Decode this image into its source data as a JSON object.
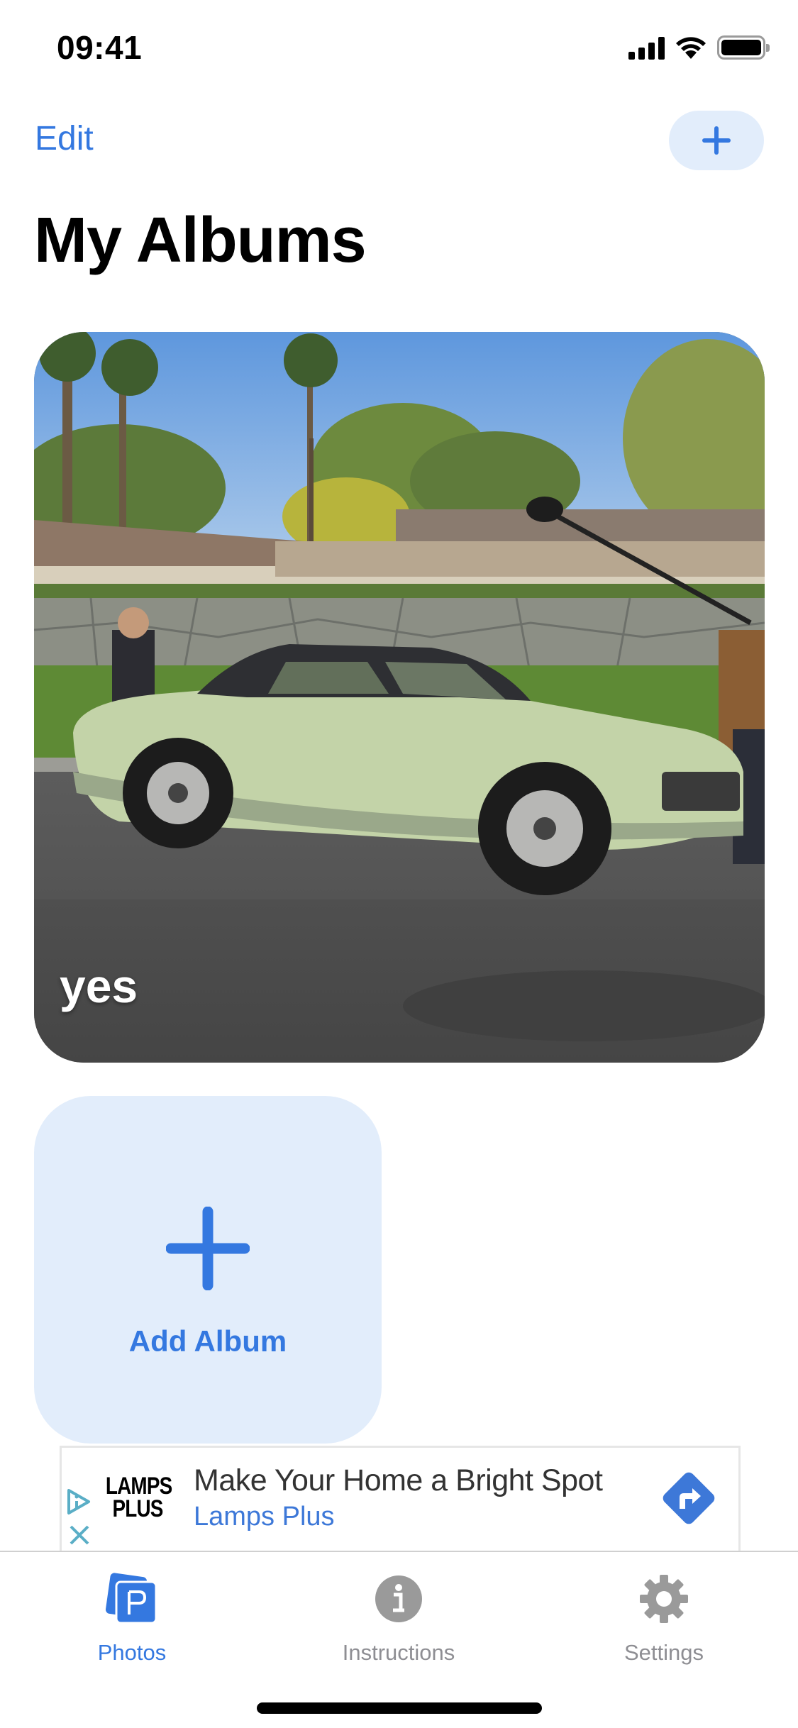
{
  "status_bar": {
    "time": "09:41",
    "icons": [
      "cellular-signal-icon",
      "wifi-icon",
      "battery-icon"
    ]
  },
  "nav": {
    "edit_label": "Edit",
    "add_button_icon": "plus-icon"
  },
  "page": {
    "title": "My Albums"
  },
  "albums": [
    {
      "title": "yes",
      "thumbnail": "photo of a pale green classic car parked on a street"
    }
  ],
  "add_album": {
    "label": "Add Album",
    "icon": "plus-icon"
  },
  "ad": {
    "logo_line1": "LAMPS",
    "logo_line2": "PLUS",
    "headline": "Make Your Home a Bright Spot",
    "advertiser": "Lamps Plus",
    "icons": [
      "ad-info-icon",
      "ad-close-icon",
      "directions-arrow-icon"
    ]
  },
  "tab_bar": {
    "items": [
      {
        "label": "Photos",
        "icon": "photos-icon",
        "active": true
      },
      {
        "label": "Instructions",
        "icon": "info-icon",
        "active": false
      },
      {
        "label": "Settings",
        "icon": "gear-icon",
        "active": false
      }
    ]
  },
  "colors": {
    "accent": "#3478e0",
    "accent_light": "#e2edfb",
    "inactive": "#8e8e93",
    "ad_teal": "#5aaec6"
  }
}
